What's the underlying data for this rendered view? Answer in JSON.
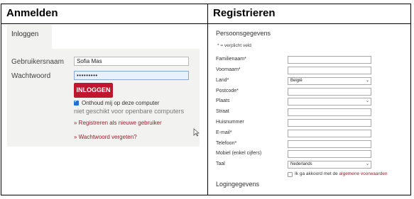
{
  "login": {
    "title": "Anmelden",
    "tab_label": "Inloggen",
    "username_label": "Gebruikersnaam",
    "username_value": "Sofia Mas",
    "password_label": "Wachtwoord",
    "password_value": "•••••••••",
    "login_button": "INLOGGEN",
    "remember_label": "Onthoud mij op deze computer",
    "remember_checked": true,
    "public_warning": "niet geschikt voor openbare computers",
    "register_link": "» Registreren als nieuwe gebruiker",
    "forgot_link": "» Wachtwoord vergeten?"
  },
  "register": {
    "title": "Registrieren",
    "section_personal": "Persoonsgegevens",
    "required_note": "* = verplicht veld",
    "fields": [
      {
        "label": "Familienaam*",
        "value": ""
      },
      {
        "label": "Voornaam*",
        "value": ""
      },
      {
        "label": "Land*",
        "value": "België",
        "select": true
      },
      {
        "label": "Postcode*",
        "value": ""
      },
      {
        "label": "Plaats",
        "value": "",
        "select": true
      },
      {
        "label": "Straat",
        "value": ""
      },
      {
        "label": "Huisnummer",
        "value": ""
      },
      {
        "label": "E-mail*",
        "value": ""
      },
      {
        "label": "Telefoon*",
        "value": ""
      },
      {
        "label": "Mobiel (enkel cijfers)",
        "value": ""
      },
      {
        "label": "Taal",
        "value": "Nederlands",
        "select": true
      }
    ],
    "agree_text": "Ik ga akkoord met de",
    "agree_link": "algemene voorwaarden",
    "section_login": "Logingegevens"
  },
  "colors": {
    "brand_red": "#c0172f",
    "link_red": "#9e1b2b",
    "panel_bg": "#f2f2f0"
  },
  "icons": {
    "cursor": "mouse-pointer-icon",
    "select_arrow": "chevron-down-icon"
  }
}
